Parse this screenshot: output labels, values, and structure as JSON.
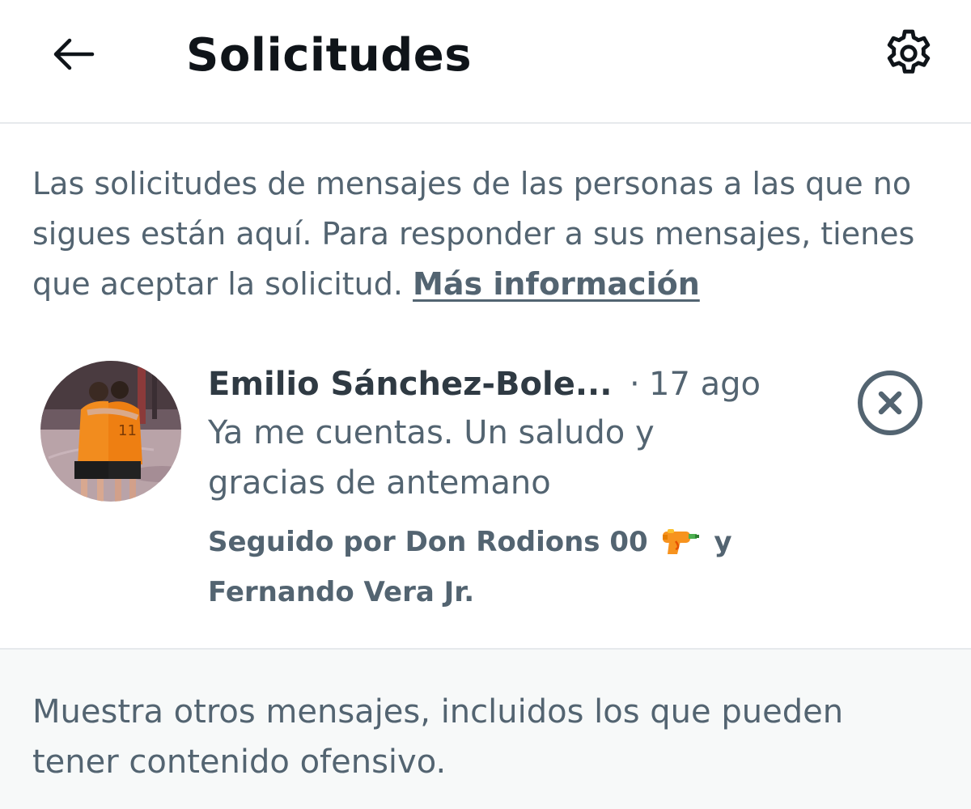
{
  "header": {
    "title": "Solicitudes",
    "back_icon": "arrow-left-icon",
    "settings_icon": "gear-icon"
  },
  "intro": {
    "text": "Las solicitudes de mensajes de las personas a las que no sigues están aquí. Para responder a sus mensajes, tienes que aceptar la solicitud.",
    "link_label": "Más información"
  },
  "request": {
    "sender_name": "Emilio Sánchez-Bole...",
    "separator": "·",
    "timestamp": "17 ago",
    "preview": "Ya me cuentas. Un saludo y gracias de antemano",
    "followed_prefix": "Seguido por Don Rodions 00",
    "followed_emoji": "water-pistol-emoji",
    "followed_suffix": "y Fernando Vera Jr.",
    "dismiss_icon": "close-circle-icon"
  },
  "more": {
    "text": "Muestra otros mensajes, incluidos los que pueden tener contenido ofensivo."
  },
  "colors": {
    "text_primary": "#0f1419",
    "text_secondary": "#536471",
    "divider": "#e6e9ec",
    "muted_bg": "#f7f9f9",
    "jersey_orange": "#f28c1e"
  }
}
